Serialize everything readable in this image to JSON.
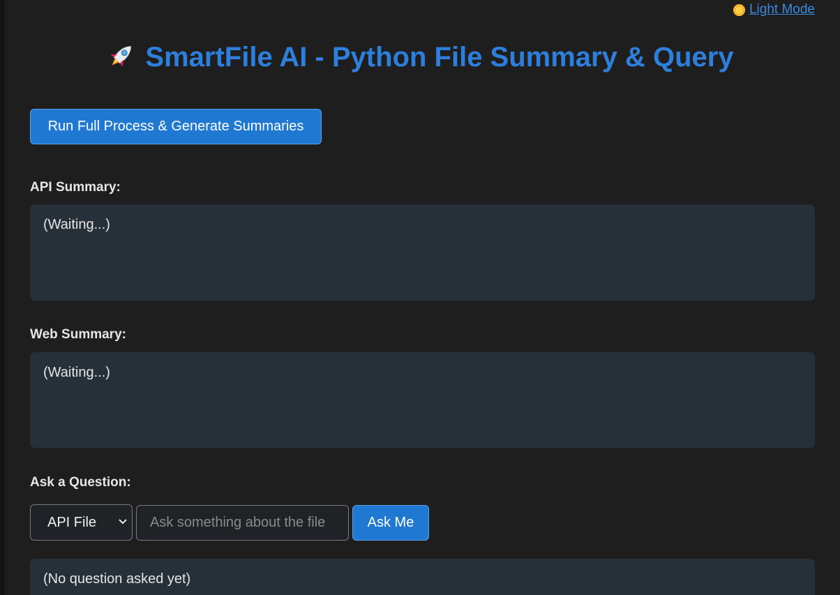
{
  "header": {
    "theme_toggle_label": "Light Mode",
    "theme_toggle_icon": "sun-icon",
    "title": "SmartFile AI - Python File Summary & Query",
    "title_icon": "rocket-icon"
  },
  "actions": {
    "run_button_label": "Run Full Process & Generate Summaries"
  },
  "api_summary": {
    "label": "API Summary:",
    "content": "(Waiting...)"
  },
  "web_summary": {
    "label": "Web Summary:",
    "content": "(Waiting...)"
  },
  "question": {
    "label": "Ask a Question:",
    "source_select_value": "API File",
    "input_placeholder": "Ask something about the file",
    "input_value": "",
    "ask_button_label": "Ask Me",
    "answer": "(No question asked yet)"
  },
  "colors": {
    "accent": "#1f78d1",
    "title": "#2e7fdc",
    "background": "#1e1e1e",
    "panel": "#263038"
  }
}
